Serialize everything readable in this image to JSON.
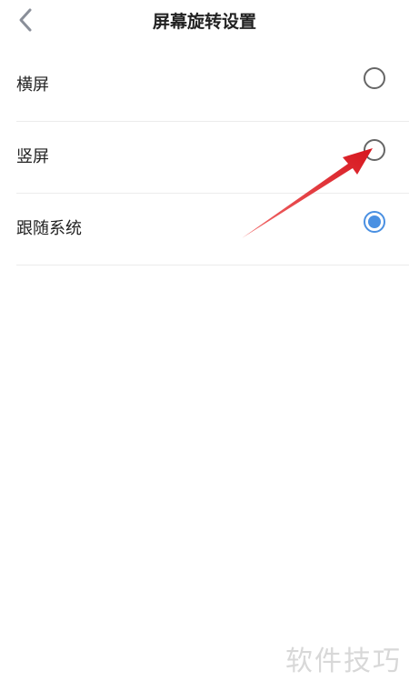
{
  "header": {
    "title": "屏幕旋转设置",
    "back_icon": "chevron-left-icon"
  },
  "options": [
    {
      "label": "横屏",
      "selected": false
    },
    {
      "label": "竖屏",
      "selected": false
    },
    {
      "label": "跟随系统",
      "selected": true
    }
  ],
  "colors": {
    "accent": "#4a90e2",
    "radio_border": "#666666",
    "divider": "#ececec",
    "annotation_arrow": "#e8232b",
    "watermark": "#d8d8d8"
  },
  "watermark": {
    "text": "软件技巧"
  }
}
